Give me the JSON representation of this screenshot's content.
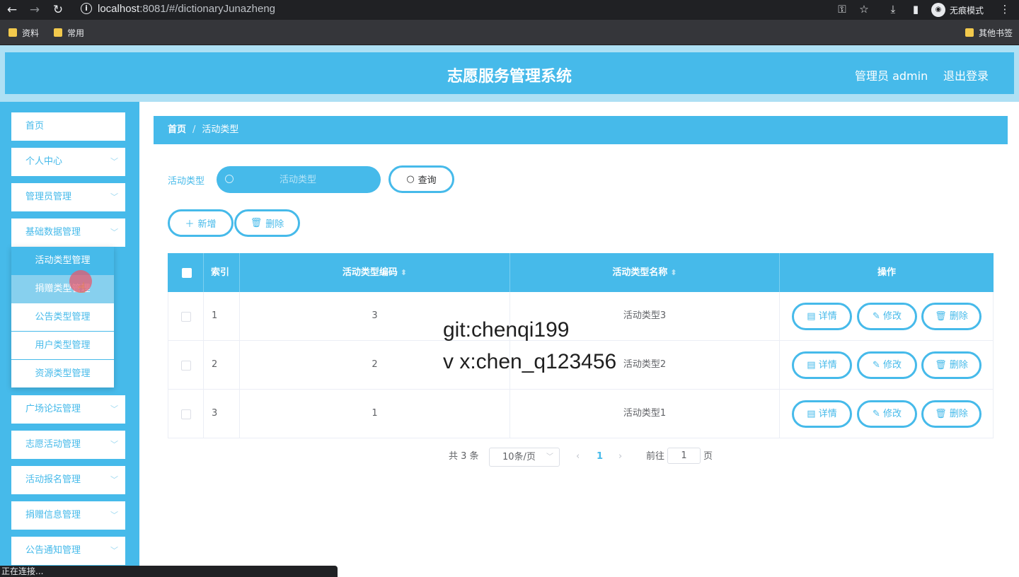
{
  "browser": {
    "url_host": "localhost",
    "url_path": ":8081/#/dictionaryJunazheng",
    "incognito_label": "无痕模式",
    "bookmarks": [
      "资料",
      "常用"
    ],
    "other_bookmarks": "其他书签",
    "status_text": "正在连接..."
  },
  "header": {
    "title": "志愿服务管理系统",
    "user": "管理员 admin",
    "logout": "退出登录"
  },
  "sidebar": {
    "items": [
      {
        "label": "首页"
      },
      {
        "label": "个人中心"
      },
      {
        "label": "管理员管理"
      },
      {
        "label": "基础数据管理"
      }
    ],
    "submenu": [
      {
        "label": "活动类型管理"
      },
      {
        "label": "捐赠类型管理"
      },
      {
        "label": "公告类型管理"
      },
      {
        "label": "用户类型管理"
      },
      {
        "label": "资源类型管理"
      }
    ],
    "items_after": [
      {
        "label": "广场论坛管理"
      },
      {
        "label": "志愿活动管理"
      },
      {
        "label": "活动报名管理"
      },
      {
        "label": "捐赠信息管理"
      },
      {
        "label": "公告通知管理"
      }
    ]
  },
  "breadcrumb": {
    "home": "首页",
    "separator": "/",
    "current": "活动类型"
  },
  "search": {
    "label": "活动类型",
    "placeholder": "活动类型",
    "query_button": "查询"
  },
  "toolbar": {
    "add_button": "新增",
    "delete_button": "删除"
  },
  "table": {
    "columns": [
      "索引",
      "活动类型编码",
      "活动类型名称",
      "操作"
    ],
    "rows": [
      {
        "index": "1",
        "code": "3",
        "name": "活动类型3"
      },
      {
        "index": "2",
        "code": "2",
        "name": "活动类型2"
      },
      {
        "index": "3",
        "code": "1",
        "name": "活动类型1"
      }
    ],
    "actions": {
      "detail": "详情",
      "edit": "修改",
      "delete": "删除"
    }
  },
  "pagination": {
    "total": "共 3 条",
    "page_size": "10条/页",
    "current_page": "1",
    "goto_prefix": "前往",
    "goto_value": "1",
    "goto_suffix": "页"
  },
  "watermark": {
    "line1": "git:chenqi199",
    "line2": "v x:chen_q123456"
  },
  "colors": {
    "accent": "#46baea",
    "header_band": "#aee0f4",
    "chrome": "#202124"
  }
}
